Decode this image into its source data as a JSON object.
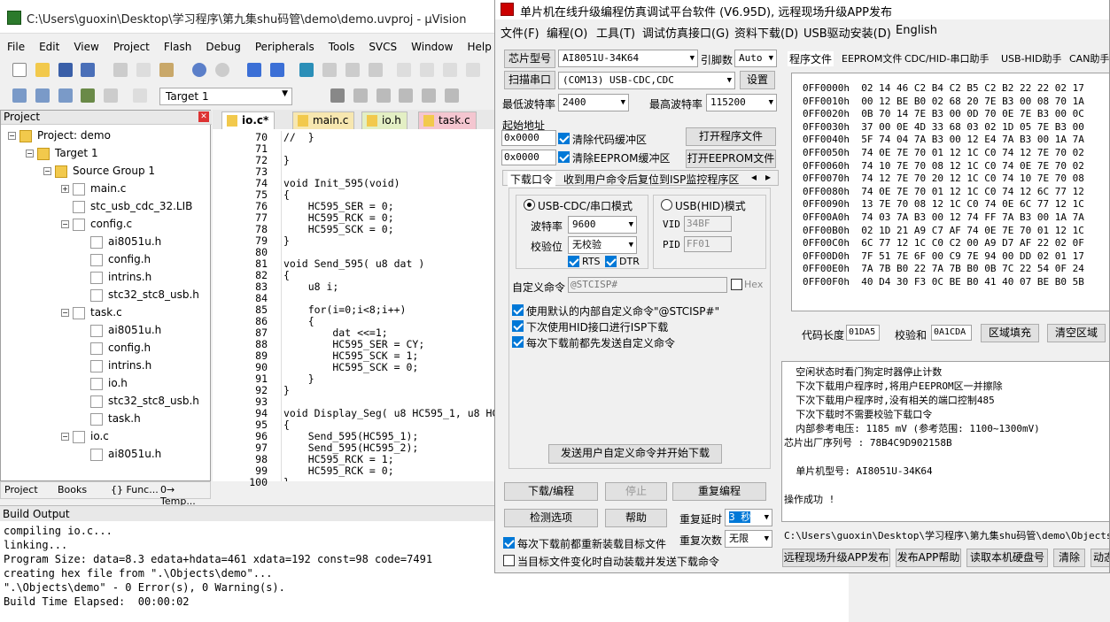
{
  "uv": {
    "title": "C:\\Users\\guoxin\\Desktop\\学习程序\\第九集shu码管\\demo\\demo.uvproj - µVision",
    "menu": [
      "File",
      "Edit",
      "View",
      "Project",
      "Flash",
      "Debug",
      "Peripherals",
      "Tools",
      "SVCS",
      "Window",
      "Help"
    ],
    "target_select": "Target 1",
    "project_panel_title": "Project",
    "tree": [
      {
        "label": "Project: demo",
        "kind": "root"
      },
      {
        "label": "Target 1",
        "kind": "target"
      },
      {
        "label": "Source Group 1",
        "kind": "folder"
      },
      {
        "label": "main.c",
        "kind": "file"
      },
      {
        "label": "stc_usb_cdc_32.LIB",
        "kind": "file"
      },
      {
        "label": "config.c",
        "kind": "file"
      },
      {
        "label": "ai8051u.h",
        "kind": "file"
      },
      {
        "label": "config.h",
        "kind": "file"
      },
      {
        "label": "intrins.h",
        "kind": "file"
      },
      {
        "label": "stc32_stc8_usb.h",
        "kind": "file"
      },
      {
        "label": "task.c",
        "kind": "file"
      },
      {
        "label": "ai8051u.h",
        "kind": "file"
      },
      {
        "label": "config.h",
        "kind": "file"
      },
      {
        "label": "intrins.h",
        "kind": "file"
      },
      {
        "label": "io.h",
        "kind": "file"
      },
      {
        "label": "stc32_stc8_usb.h",
        "kind": "file"
      },
      {
        "label": "task.h",
        "kind": "file"
      },
      {
        "label": "io.c",
        "kind": "file"
      },
      {
        "label": "ai8051u.h",
        "kind": "file"
      }
    ],
    "panel_tabs": [
      "Project",
      "Books",
      "{} Func...",
      "0→ Temp..."
    ],
    "editor_tabs": [
      "io.c*",
      "main.c",
      "io.h",
      "task.c"
    ],
    "code": [
      {
        "n": "70",
        "t": "//  }"
      },
      {
        "n": "71",
        "t": ""
      },
      {
        "n": "72",
        "t": "}"
      },
      {
        "n": "73",
        "t": ""
      },
      {
        "n": "74",
        "t": "void Init_595(void)"
      },
      {
        "n": "75",
        "t": "{"
      },
      {
        "n": "76",
        "t": "    HC595_SER = 0;"
      },
      {
        "n": "77",
        "t": "    HC595_RCK = 0;"
      },
      {
        "n": "78",
        "t": "    HC595_SCK = 0;"
      },
      {
        "n": "79",
        "t": "}"
      },
      {
        "n": "80",
        "t": ""
      },
      {
        "n": "81",
        "t": "void Send_595( u8 dat )"
      },
      {
        "n": "82",
        "t": "{"
      },
      {
        "n": "83",
        "t": "    u8 i;"
      },
      {
        "n": "84",
        "t": ""
      },
      {
        "n": "85",
        "t": "    for(i=0;i<8;i++)"
      },
      {
        "n": "86",
        "t": "    {"
      },
      {
        "n": "87",
        "t": "        dat <<=1;"
      },
      {
        "n": "88",
        "t": "        HC595_SER = CY;"
      },
      {
        "n": "89",
        "t": "        HC595_SCK = 1;"
      },
      {
        "n": "90",
        "t": "        HC595_SCK = 0;"
      },
      {
        "n": "91",
        "t": "    }"
      },
      {
        "n": "92",
        "t": "}"
      },
      {
        "n": "93",
        "t": ""
      },
      {
        "n": "94",
        "t": "void Display_Seg( u8 HC595_1, u8 HC"
      },
      {
        "n": "95",
        "t": "{"
      },
      {
        "n": "96",
        "t": "    Send_595(HC595_1);"
      },
      {
        "n": "97",
        "t": "    Send_595(HC595_2);"
      },
      {
        "n": "98",
        "t": "    HC595_RCK = 1;"
      },
      {
        "n": "99",
        "t": "    HC595_RCK = 0;"
      },
      {
        "n": "100",
        "t": "}"
      }
    ],
    "build_title": "Build Output",
    "build_lines": [
      "compiling io.c...",
      "linking...",
      "Program Size: data=8.3 edata+hdata=461 xdata=192 const=98 code=7491",
      "creating hex file from \".\\Objects\\demo\"...",
      "\".\\Objects\\demo\" - 0 Error(s), 0 Warning(s).",
      "Build Time Elapsed:  00:00:02"
    ]
  },
  "stc": {
    "title": "单片机在线升级编程仿真调试平台软件 (V6.95D), 远程现场升级APP发布",
    "menu": [
      "文件(F)",
      "编程(O)",
      "工具(T)",
      "调试仿真接口(G)",
      "资料下载(D)",
      "USB驱动安装(D)",
      "English"
    ],
    "chip_btn": "芯片型号",
    "chip": "AI8051U-34K64",
    "pins_label": "引脚数",
    "pins": "Auto",
    "scan_btn": "扫描串口",
    "port": "(COM13) USB-CDC,CDC",
    "settings_btn": "设置",
    "min_baud_label": "最低波特率",
    "min_baud": "2400",
    "max_baud_label": "最高波特率",
    "max_baud": "115200",
    "start_addr_label": "起始地址",
    "addr1": "0x0000",
    "clear_code": "清除代码缓冲区",
    "open_prog": "打开程序文件",
    "addr2": "0x0000",
    "clear_eeprom": "清除EEPROM缓冲区",
    "open_eeprom": "打开EEPROM文件",
    "sub_tabs": [
      "下载口令",
      "收到用户命令后复位到ISP监控程序区"
    ],
    "cdc_mode": "USB-CDC/串口模式",
    "hid_mode": "USB(HID)模式",
    "baud_label": "波特率",
    "baud": "9600",
    "parity_label": "校验位",
    "parity": "无校验",
    "rts": "RTS",
    "dtr": "DTR",
    "vid_label": "VID",
    "vid": "34BF",
    "pid_label": "PID",
    "pid": "FF01",
    "custom_cmd_label": "自定义命令",
    "custom_cmd": "@STCISP#",
    "hex_label": "Hex",
    "opt1": "使用默认的内部自定义命令\"@STCISP#\"",
    "opt2": "下次使用HID接口进行ISP下载",
    "opt3": "每次下载前都先发送自定义命令",
    "send_btn": "发送用户自定义命令并开始下载",
    "download_btn": "下载/编程",
    "stop_btn": "停止",
    "reprog_btn": "重复编程",
    "detect_btn": "检测选项",
    "help_btn": "帮助",
    "repeat_delay_label": "重复延时",
    "repeat_delay": "3 秒",
    "repeat_count_label": "重复次数",
    "repeat_count": "无限",
    "reload_opt": "每次下载前都重新装载目标文件",
    "auto_opt": "当目标文件变化时自动装载并发送下载命令",
    "right_tabs": [
      "程序文件",
      "EEPROM文件",
      "CDC/HID-串口助手",
      "USB-HID助手",
      "CAN助手"
    ],
    "hex_rows": [
      "0FF0000h  02 14 46 C2 B4 C2 B5 C2 B2 22 22 02 17",
      "0FF0010h  00 12 BE B0 02 68 20 7E B3 00 08 70 1A",
      "0FF0020h  0B 70 14 7E B3 00 0D 70 0E 7E B3 00 0C",
      "0FF0030h  37 00 0E 4D 33 68 03 02 1D 05 7E B3 00",
      "0FF0040h  5F 74 04 7A B3 00 12 E4 7A B3 00 1A 7A",
      "0FF0050h  74 0E 7E 70 01 12 1C C0 74 12 7E 70 02",
      "0FF0060h  74 10 7E 70 08 12 1C C0 74 0E 7E 70 02",
      "0FF0070h  74 12 7E 70 20 12 1C C0 74 10 7E 70 08",
      "0FF0080h  74 0E 7E 70 01 12 1C C0 74 12 6C 77 12",
      "0FF0090h  13 7E 70 08 12 1C C0 74 0E 6C 77 12 1C",
      "0FF00A0h  74 03 7A B3 00 12 74 FF 7A B3 00 1A 7A",
      "0FF00B0h  02 1D 21 A9 C7 AF 74 0E 7E 70 01 12 1C",
      "0FF00C0h  6C 77 12 1C C0 C2 00 A9 D7 AF 22 02 0F",
      "0FF00D0h  7F 51 7E 6F 00 C9 7E 94 00 DD 02 01 17",
      "0FF00E0h  7A 7B B0 22 7A 7B B0 0B 7C 22 54 0F 24",
      "0FF00F0h  40 D4 30 F3 0C BE B0 41 40 07 BE B0 5B"
    ],
    "code_len_label": "代码长度",
    "code_len": "01DA5",
    "checksum_label": "校验和",
    "checksum": "0A1CDA",
    "fill_btn": "区域填充",
    "clear_btn": "清空区域",
    "log_lines": [
      "  空闲状态时看门狗定时器停止计数",
      "  下次下载用户程序时,将用户EEPROM区一并擦除",
      "  下次下载用户程序时,没有相关的端口控制485",
      "  下次下载时不需要校验下载口令",
      "  内部参考电压: 1185 mV (参考范围: 1100~1300mV)",
      "芯片出厂序列号 : 78B4C9D902158B",
      "",
      "  单片机型号: AI8051U-34K64",
      "",
      "操作成功 !"
    ],
    "path": "C:\\Users\\guoxin\\Desktop\\学习程序\\第九集shu码管\\demo\\Objects\\de",
    "bottom_btns": [
      "远程现场升级APP发布",
      "发布APP帮助",
      "读取本机硬盘号",
      "清除",
      "动态"
    ]
  }
}
